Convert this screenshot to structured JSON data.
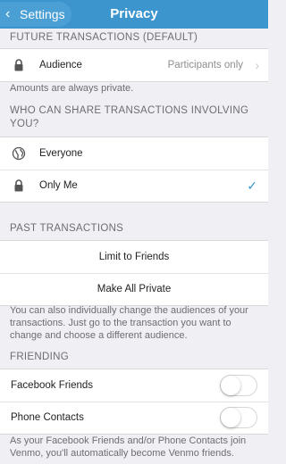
{
  "nav": {
    "back_label": "Settings",
    "title": "Privacy"
  },
  "future": {
    "header": "FUTURE TRANSACTIONS (DEFAULT)",
    "audience_label": "Audience",
    "audience_value": "Participants only",
    "footer": "Amounts are always private."
  },
  "share": {
    "header": "WHO CAN SHARE TRANSACTIONS INVOLVING YOU?",
    "options": [
      {
        "label": "Everyone",
        "icon": "globe-icon",
        "selected": false
      },
      {
        "label": "Only Me",
        "icon": "lock-icon",
        "selected": true
      }
    ]
  },
  "past": {
    "header": "PAST TRANSACTIONS",
    "limit_label": "Limit to Friends",
    "private_label": "Make All Private",
    "footer": "You can also individually change the audiences of your transactions. Just go to the transaction you want to change and choose a different audience."
  },
  "friending": {
    "header": "FRIENDING",
    "facebook_label": "Facebook Friends",
    "facebook_on": false,
    "phone_label": "Phone Contacts",
    "phone_on": false,
    "footer": "As your Facebook Friends and/or Phone Contacts join Venmo, you'll automatically become Venmo friends."
  },
  "colors": {
    "accent": "#3d95ce",
    "background": "#efeff4"
  }
}
